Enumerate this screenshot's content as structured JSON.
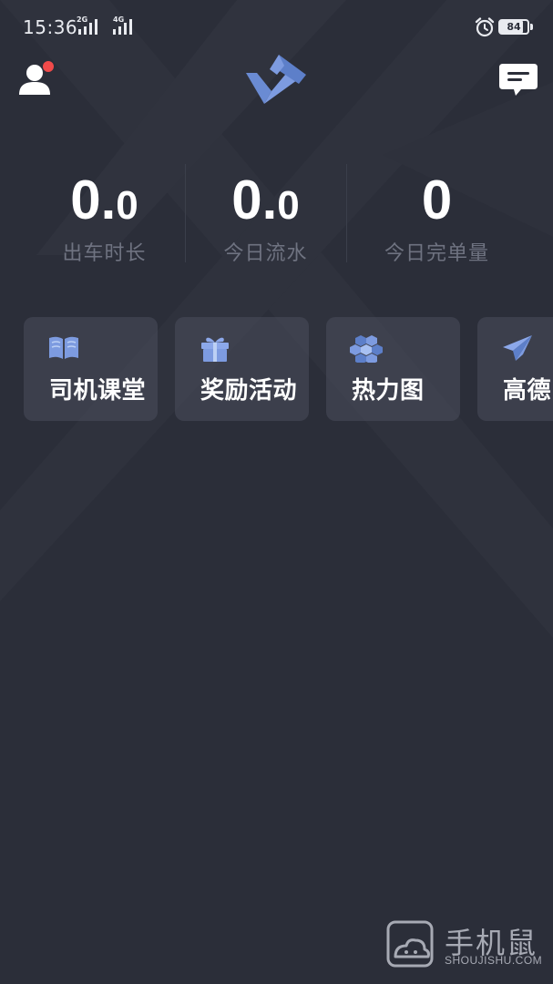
{
  "status_bar": {
    "time": "15:36",
    "signal_1_tag": "2G",
    "signal_2_tag": "4G",
    "battery_percent": "84"
  },
  "header": {
    "avatar_icon": "user-avatar-icon",
    "notification_dot_color": "#f04a4a",
    "logo": "app-logo",
    "message_icon": "message-icon"
  },
  "stats": [
    {
      "value_int": "0.",
      "value_dec": "0",
      "label": "出车时长"
    },
    {
      "value_int": "0.",
      "value_dec": "0",
      "label": "今日流水"
    },
    {
      "value_int": "0",
      "value_dec": "",
      "label": "今日完单量"
    }
  ],
  "quick_entries": [
    {
      "label": "司机课堂",
      "icon": "book-icon"
    },
    {
      "label": "奖励活动",
      "icon": "gift-icon"
    },
    {
      "label": "热力图",
      "icon": "heatmap-hexagon-icon"
    },
    {
      "label": "高德",
      "icon": "paper-plane-icon"
    }
  ],
  "watermark": {
    "brand": "手机鼠",
    "domain": "SHOUJISHU.COM"
  },
  "colors": {
    "background": "#2b2e39",
    "accent_blue": "#6e8fd6",
    "label_gray": "#6f7381",
    "card_bg": "#3d404c"
  }
}
